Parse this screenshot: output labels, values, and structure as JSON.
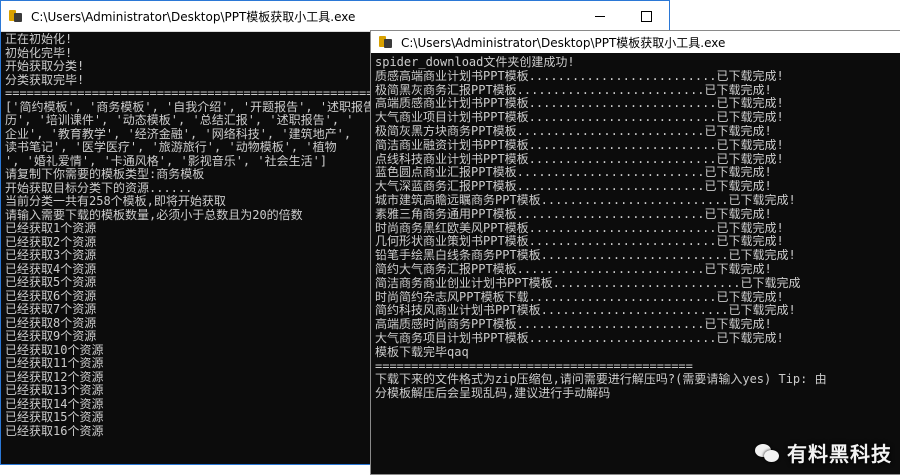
{
  "window1": {
    "title": "C:\\Users\\Administrator\\Desktop\\PPT模板获取小工具.exe",
    "lines": [
      "正在初始化!",
      "初始化完毕!",
      "开始获取分类!",
      "分类获取完毕!",
      "==============================================================",
      "['简约模板', '商务模板', '自我介绍', '开题报告', '述职报告',",
      "历', '培训课件', '动态模板', '总结汇报', '述职报告', '",
      "企业', '教育教学', '经济金融', '网络科技', '建筑地产',",
      "读书笔记', '医学医疗', '旅游旅行', '动物模板', '植物",
      "', '婚礼爱情', '卡通风格', '影视音乐', '社会生活']",
      "请复制下你需要的模板类型:商务模板",
      "开始获取目标分类下的资源......",
      "当前分类一共有258个模板,即将开始获取",
      "请输入需要下载的模板数量,必须小于总数且为20的倍数",
      "已经获取1个资源",
      "已经获取2个资源",
      "已经获取3个资源",
      "已经获取4个资源",
      "已经获取5个资源",
      "已经获取6个资源",
      "已经获取7个资源",
      "已经获取8个资源",
      "已经获取9个资源",
      "已经获取10个资源",
      "已经获取11个资源",
      "已经获取12个资源",
      "已经获取13个资源",
      "已经获取14个资源",
      "已经获取15个资源",
      "已经获取16个资源"
    ]
  },
  "window2": {
    "title": "C:\\Users\\Administrator\\Desktop\\PPT模板获取小工具.exe",
    "lines": [
      "spider_download文件夹创建成功!",
      "质感高端商业计划书PPT模板..........................已下载完成!",
      "极简黑灰商务汇报PPT模板..........................已下载完成!",
      "高端质感商业计划书PPT模板..........................已下载完成!",
      "大气商业项目计划书PPT模板..........................已下载完成!",
      "极简灰黑方块商务PPT模板..........................已下载完成!",
      "简洁商业融资计划书PPT模板..........................已下载完成!",
      "点线科技商业计划书PPT模板..........................已下载完成!",
      "蓝色圆点商业汇报PPT模板..........................已下载完成!",
      "大气深蓝商务汇报PPT模板..........................已下载完成!",
      "城市建筑高瞻远瞩商务PPT模板..........................已下载完成!",
      "素雅三角商务通用PPT模板..........................已下载完成!",
      "时尚商务黑红欧美风PPT模板..........................已下载完成!",
      "几何形状商业策划书PPT模板..........................已下载完成!",
      "铅笔手绘黑白线条商务PPT模板..........................已下载完成!",
      "简约大气商务汇报PPT模板..........................已下载完成!",
      "简洁商务商业创业计划书PPT模板..........................已下载完成",
      "时尚简约杂志风PPT模板下载..........................已下载完成!",
      "简约科技风商业计划书PPT模板..........................已下载完成!",
      "高端质感时尚商务PPT模板..........................已下载完成!",
      "大气商务项目计划书PPT模板..........................已下载完成!",
      "模板下载完毕qaq",
      "============================================",
      "下载下来的文件格式为zip压缩包,请问需要进行解压吗?(需要请输入yes) Tip: 由",
      "分模板解压后会呈现乱码,建议进行手动解码"
    ]
  },
  "watermark": {
    "text": "有料黑科技"
  }
}
